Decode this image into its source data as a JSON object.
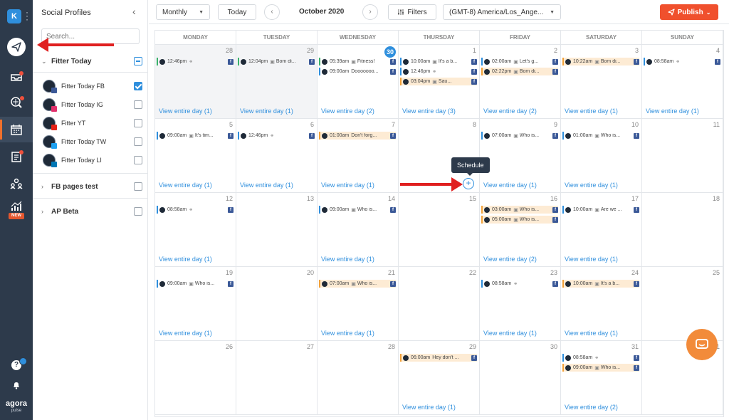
{
  "app": {
    "account_initial": "K",
    "logo_text": "agora",
    "logo_sub": "pulse",
    "new_badge": "NEW",
    "help_label": "?"
  },
  "nav_icons": [
    "publish-icon",
    "inbox-icon",
    "listening-icon",
    "calendar-icon",
    "queue-icon",
    "users-icon",
    "reports-icon",
    "help-icon",
    "bell-icon"
  ],
  "sidebar": {
    "title": "Social Profiles",
    "collapse_icon": "chevron-left-icon",
    "search_placeholder": "Search...",
    "groups": [
      {
        "name": "Fitter Today",
        "expanded": true,
        "state": "partial",
        "profiles": [
          {
            "name": "Fitter Today FB",
            "network": "facebook",
            "color": "#3b5998",
            "checked": true
          },
          {
            "name": "Fitter Today IG",
            "network": "instagram",
            "color": "#e1306c",
            "checked": false
          },
          {
            "name": "Fitter YT",
            "network": "youtube",
            "color": "#e62117",
            "checked": false
          },
          {
            "name": "Fitter Today TW",
            "network": "twitter",
            "color": "#1da1f2",
            "checked": false
          },
          {
            "name": "Fitter Today LI",
            "network": "linkedin",
            "color": "#0077b5",
            "checked": false
          }
        ]
      },
      {
        "name": "FB pages test",
        "expanded": false,
        "state": "unchecked"
      },
      {
        "name": "AP Beta",
        "expanded": false,
        "state": "unchecked"
      }
    ]
  },
  "toolbar": {
    "view_select": "Monthly",
    "today_label": "Today",
    "prev_icon": "chevron-left-icon",
    "next_icon": "chevron-right-icon",
    "month_label": "October 2020",
    "filters_label": "Filters",
    "timezone": "(GMT-8) America/Los_Ange...",
    "publish_label": "Publish"
  },
  "calendar": {
    "day_names": [
      "MONDAY",
      "TUESDAY",
      "WEDNESDAY",
      "THURSDAY",
      "FRIDAY",
      "SATURDAY",
      "SUNDAY"
    ],
    "view_day_prefix": "View entire day",
    "tooltip": "Schedule",
    "weeks": [
      [
        {
          "day": "28",
          "past": true,
          "view": "View entire day (1)",
          "posts": [
            {
              "time": "12:46pm",
              "type": "link",
              "text": "",
              "status": "green",
              "pending": false
            }
          ]
        },
        {
          "day": "29",
          "past": true,
          "view": "View entire day (1)",
          "posts": [
            {
              "time": "12:04pm",
              "type": "image",
              "text": "Bom di...",
              "status": "green",
              "pending": false
            }
          ]
        },
        {
          "day": "30",
          "today": true,
          "view": "View entire day (2)",
          "posts": [
            {
              "time": "05:39am",
              "type": "image",
              "text": "Fitness!",
              "status": "green",
              "pending": false
            },
            {
              "time": "09:00am",
              "type": "",
              "text": "Dooooooo...",
              "status": "blue",
              "pending": false
            }
          ]
        },
        {
          "day": "1",
          "view": "View entire day (3)",
          "posts": [
            {
              "time": "10:00am",
              "type": "image",
              "text": "It's a b...",
              "status": "blue",
              "pending": false
            },
            {
              "time": "12:46pm",
              "type": "link",
              "text": "",
              "status": "blue",
              "pending": false
            },
            {
              "time": "03:04pm",
              "type": "image",
              "text": "Sau...",
              "status": "orange",
              "pending": true
            }
          ]
        },
        {
          "day": "2",
          "view": "View entire day (2)",
          "posts": [
            {
              "time": "02:00am",
              "type": "image",
              "text": "Let's g...",
              "status": "blue",
              "pending": false
            },
            {
              "time": "02:22pm",
              "type": "image",
              "text": "Bom di...",
              "status": "orange",
              "pending": true
            }
          ]
        },
        {
          "day": "3",
          "view": "View entire day (1)",
          "posts": [
            {
              "time": "10:22am",
              "type": "image",
              "text": "Bom di...",
              "status": "orange",
              "pending": true
            }
          ]
        },
        {
          "day": "4",
          "view": "View entire day (1)",
          "posts": [
            {
              "time": "08:58am",
              "type": "link",
              "text": "",
              "status": "blue",
              "pending": false
            }
          ]
        }
      ],
      [
        {
          "day": "5",
          "view": "View entire day (1)",
          "posts": [
            {
              "time": "09:00am",
              "type": "image",
              "text": "It's tim...",
              "status": "blue",
              "pending": false
            }
          ]
        },
        {
          "day": "6",
          "view": "View entire day (1)",
          "posts": [
            {
              "time": "12:46pm",
              "type": "link",
              "text": "",
              "status": "blue",
              "pending": false
            }
          ]
        },
        {
          "day": "7",
          "view": "View entire day (1)",
          "posts": [
            {
              "time": "01:00am",
              "type": "",
              "text": "Don't forg...",
              "status": "orange",
              "pending": true
            }
          ]
        },
        {
          "day": "8",
          "view": "",
          "posts": []
        },
        {
          "day": "9",
          "view": "View entire day (1)",
          "posts": [
            {
              "time": "07:00am",
              "type": "image",
              "text": "Who is...",
              "status": "blue",
              "pending": false
            }
          ]
        },
        {
          "day": "10",
          "view": "View entire day (1)",
          "posts": [
            {
              "time": "01:00am",
              "type": "image",
              "text": "Who is...",
              "status": "blue",
              "pending": false
            }
          ]
        },
        {
          "day": "11",
          "view": "",
          "posts": []
        }
      ],
      [
        {
          "day": "12",
          "view": "View entire day (1)",
          "posts": [
            {
              "time": "08:58am",
              "type": "link",
              "text": "",
              "status": "blue",
              "pending": false
            }
          ]
        },
        {
          "day": "13",
          "view": "",
          "posts": []
        },
        {
          "day": "14",
          "view": "View entire day (1)",
          "posts": [
            {
              "time": "09:00am",
              "type": "image",
              "text": "Who is...",
              "status": "blue",
              "pending": false
            }
          ]
        },
        {
          "day": "15",
          "view": "",
          "posts": []
        },
        {
          "day": "16",
          "view": "View entire day (2)",
          "posts": [
            {
              "time": "03:00am",
              "type": "image",
              "text": "Who is...",
              "status": "orange",
              "pending": true
            },
            {
              "time": "05:00am",
              "type": "image",
              "text": "Who is...",
              "status": "orange",
              "pending": true
            }
          ]
        },
        {
          "day": "17",
          "view": "View entire day (1)",
          "posts": [
            {
              "time": "10:00am",
              "type": "image",
              "text": "Are we ...",
              "status": "blue",
              "pending": false
            }
          ]
        },
        {
          "day": "18",
          "view": "",
          "posts": []
        }
      ],
      [
        {
          "day": "19",
          "view": "View entire day (1)",
          "posts": [
            {
              "time": "09:00am",
              "type": "image",
              "text": "Who is...",
              "status": "blue",
              "pending": false
            }
          ]
        },
        {
          "day": "20",
          "view": "",
          "posts": []
        },
        {
          "day": "21",
          "view": "View entire day (1)",
          "posts": [
            {
              "time": "07:00am",
              "type": "image",
              "text": "Who is...",
              "status": "orange",
              "pending": true
            }
          ]
        },
        {
          "day": "22",
          "view": "",
          "posts": []
        },
        {
          "day": "23",
          "view": "View entire day (1)",
          "posts": [
            {
              "time": "08:58am",
              "type": "link",
              "text": "",
              "status": "blue",
              "pending": false
            }
          ]
        },
        {
          "day": "24",
          "view": "View entire day (1)",
          "posts": [
            {
              "time": "10:00am",
              "type": "image",
              "text": "It's a b...",
              "status": "orange",
              "pending": true
            }
          ]
        },
        {
          "day": "25",
          "view": "",
          "posts": []
        }
      ],
      [
        {
          "day": "26",
          "view": "",
          "posts": []
        },
        {
          "day": "27",
          "view": "",
          "posts": []
        },
        {
          "day": "28",
          "view": "",
          "posts": []
        },
        {
          "day": "29",
          "view": "View entire day (1)",
          "posts": [
            {
              "time": "06:00am",
              "type": "",
              "text": "Hey don't ...",
              "status": "orange",
              "pending": true
            }
          ]
        },
        {
          "day": "30",
          "view": "",
          "posts": []
        },
        {
          "day": "31",
          "view": "View entire day (2)",
          "posts": [
            {
              "time": "08:58am",
              "type": "link",
              "text": "",
              "status": "blue",
              "pending": false
            },
            {
              "time": "09:00am",
              "type": "image",
              "text": "Who is...",
              "status": "orange",
              "pending": true
            }
          ]
        },
        {
          "day": "1",
          "view": "",
          "posts": []
        }
      ]
    ]
  },
  "colors": {
    "accent": "#2f8fdd",
    "publish": "#f0502d",
    "rail": "#2d3a4b",
    "status_green": "#3ab26b",
    "status_blue": "#2f8fdd",
    "status_orange": "#f2a23a",
    "pending_bg": "#fdebd4",
    "annotation_arrow": "#e02020",
    "chat": "#f28b3a"
  }
}
